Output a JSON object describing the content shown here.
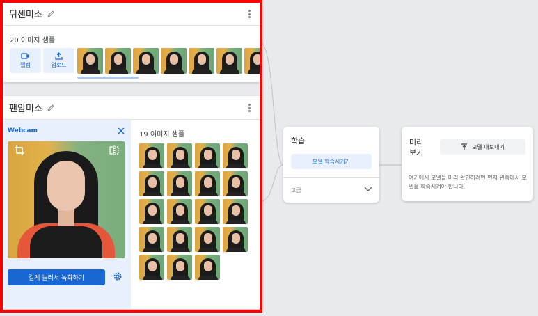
{
  "classes": [
    {
      "name": "뒤센미소",
      "samples_label": "20 이미지 샘플",
      "webcam_label": "웹캠",
      "upload_label": "업로드"
    },
    {
      "name": "팬암미소",
      "samples_label": "19 이미지 샘플",
      "webcam_panel_title": "Webcam",
      "record_label": "길게 눌러서 녹화하기"
    }
  ],
  "training": {
    "title": "학습",
    "train_button": "모델 학습시키기",
    "advanced_label": "고급"
  },
  "preview": {
    "title": "미리\n보기",
    "title_line1": "미리",
    "title_line2": "보기",
    "export_button": "모델 내보내기",
    "message": "여기에서 모델을 미리 확인하려면 먼저 왼쪽에서 모델을 학습시켜야 합니다."
  },
  "icons": {
    "edit": "pencil-icon",
    "menu": "more-vert-icon",
    "webcam": "videocam-icon",
    "upload": "upload-icon",
    "close": "close-icon",
    "crop": "crop-icon",
    "flip": "flip-icon",
    "settings": "gear-icon",
    "expand": "chevron-down-icon",
    "export": "export-icon"
  },
  "colors": {
    "accent": "#1967d2",
    "accent_light": "#e8f0fe",
    "highlight": "#ff0000",
    "background": "#e8eaed"
  }
}
